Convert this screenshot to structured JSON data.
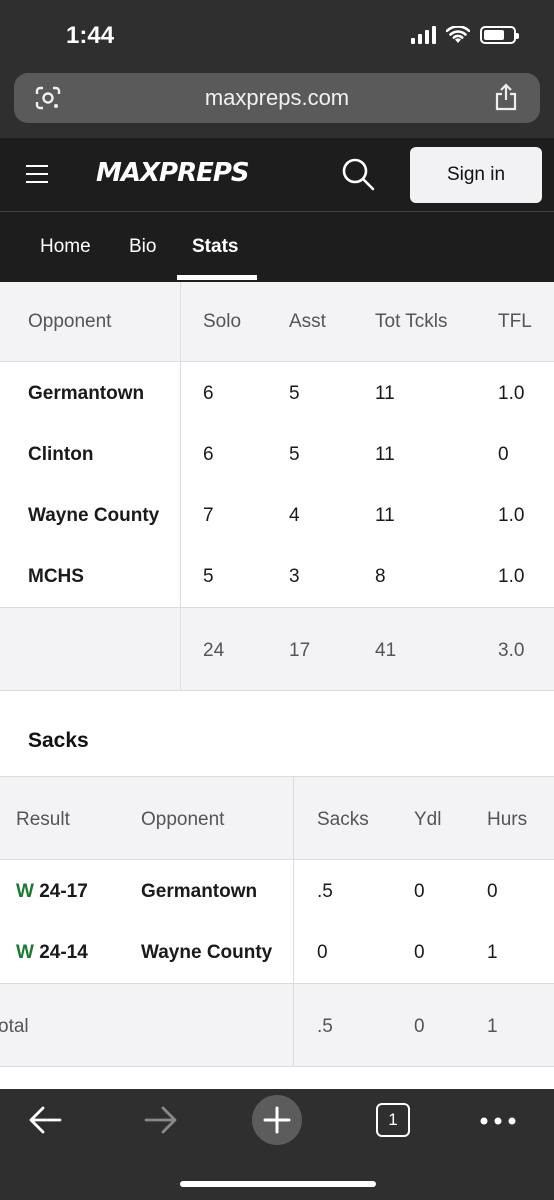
{
  "status_bar": {
    "time": "1:44"
  },
  "browser": {
    "url": "maxpreps.com"
  },
  "header": {
    "logo_text": "MAXPREPS",
    "signin_label": "Sign in"
  },
  "tabs": [
    {
      "label": "Home"
    },
    {
      "label": "Bio"
    },
    {
      "label": "Stats"
    }
  ],
  "tackles_table": {
    "columns": [
      "Opponent",
      "Solo",
      "Asst",
      "Tot Tckls",
      "TFL"
    ],
    "rows": [
      {
        "opponent": "Germantown",
        "solo": "6",
        "asst": "5",
        "tot": "11",
        "tfl": "1.0"
      },
      {
        "opponent": "Clinton",
        "solo": "6",
        "asst": "5",
        "tot": "11",
        "tfl": "0"
      },
      {
        "opponent": "Wayne County",
        "solo": "7",
        "asst": "4",
        "tot": "11",
        "tfl": "1.0"
      },
      {
        "opponent": "MCHS",
        "solo": "5",
        "asst": "3",
        "tot": "8",
        "tfl": "1.0"
      }
    ],
    "totals": {
      "solo": "24",
      "asst": "17",
      "tot": "41",
      "tfl": "3.0"
    }
  },
  "sacks_section": {
    "title": "Sacks",
    "columns": [
      "Result",
      "Opponent",
      "Sacks",
      "Ydl",
      "Hurs"
    ],
    "rows": [
      {
        "result_letter": "W",
        "score": "24-17",
        "opponent": "Germantown",
        "sacks": ".5",
        "ydl": "0",
        "hurs": "0"
      },
      {
        "result_letter": "W",
        "score": "24-14",
        "opponent": "Wayne County",
        "sacks": "0",
        "ydl": "0",
        "hurs": "1"
      }
    ],
    "totals": {
      "label": "otal",
      "sacks": ".5",
      "ydl": "0",
      "hurs": "1"
    }
  },
  "toolbar": {
    "tab_count": "1"
  },
  "colors": {
    "win": "#1d7a32",
    "chrome": "#2f2f2f",
    "header": "#1d1d1d"
  }
}
